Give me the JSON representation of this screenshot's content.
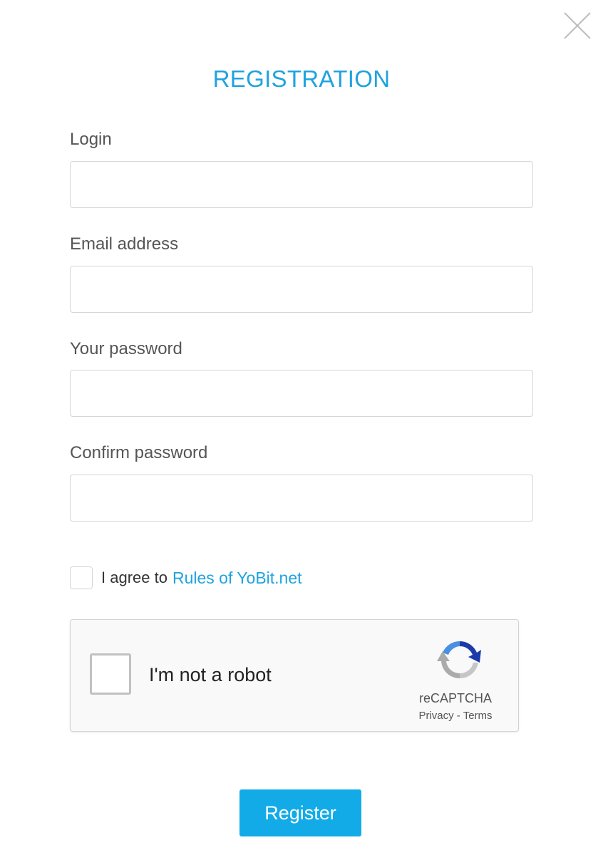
{
  "dialog": {
    "title": "REGISTRATION",
    "close_icon": "close-icon"
  },
  "form": {
    "login": {
      "label": "Login",
      "value": "",
      "placeholder": ""
    },
    "email": {
      "label": "Email address",
      "value": "",
      "placeholder": ""
    },
    "password": {
      "label": "Your password",
      "value": "",
      "placeholder": ""
    },
    "confirm_password": {
      "label": "Confirm password",
      "value": "",
      "placeholder": ""
    }
  },
  "agreement": {
    "text": "I agree to",
    "link_text": "Rules of YoBit.net",
    "checked": false
  },
  "captcha": {
    "label": "I'm not a robot",
    "brand": "reCAPTCHA",
    "privacy_label": "Privacy",
    "separator": " - ",
    "terms_label": "Terms",
    "checked": false
  },
  "submit": {
    "label": "Register"
  },
  "colors": {
    "accent": "#1fa3e0",
    "button": "#12abe8",
    "label": "#555555",
    "border": "#d6d6d6"
  }
}
